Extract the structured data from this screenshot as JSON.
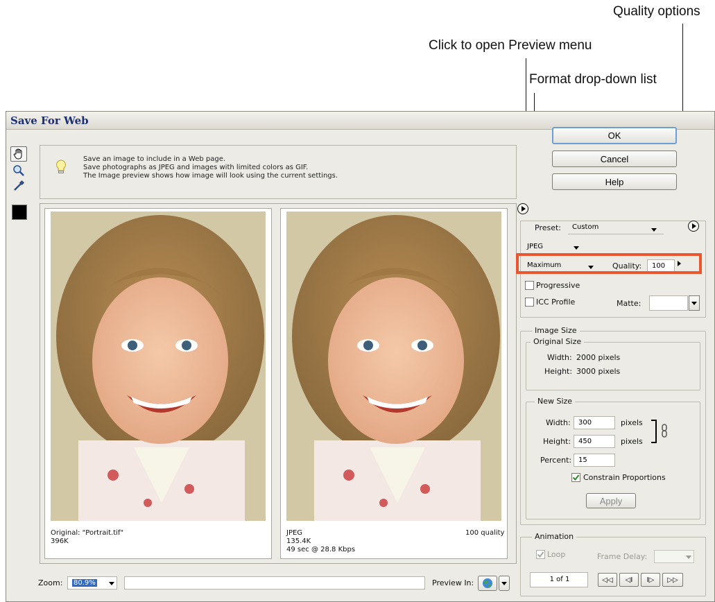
{
  "callouts": {
    "quality_options": "Quality options",
    "preview_menu": "Click to open Preview menu",
    "format_dropdown": "Format drop-down list"
  },
  "dialog": {
    "title": "Save For Web"
  },
  "info": {
    "line1": "Save an image to include in a Web page.",
    "line2": "Save photographs as JPEG and images with limited colors as GIF.",
    "line3": "The Image preview shows how image will look using the current settings."
  },
  "buttons": {
    "ok": "OK",
    "cancel": "Cancel",
    "help": "Help",
    "apply": "Apply"
  },
  "preset": {
    "label": "Preset:",
    "value": "Custom"
  },
  "format": {
    "value": "JPEG"
  },
  "quality": {
    "level": "Maximum",
    "label": "Quality:",
    "value": "100"
  },
  "options": {
    "progressive": "Progressive",
    "icc": "ICC Profile",
    "matte": "Matte:"
  },
  "image_size": {
    "legend": "Image Size",
    "original_legend": "Original Size",
    "width_label": "Width:",
    "width_value": "2000 pixels",
    "height_label": "Height:",
    "height_value": "3000 pixels",
    "new_legend": "New Size",
    "new_width": "300",
    "new_height": "450",
    "percent_label": "Percent:",
    "percent": "15",
    "pixels": "pixels",
    "constrain": "Constrain Proportions"
  },
  "animation": {
    "legend": "Animation",
    "loop": "Loop",
    "frame_delay": "Frame Delay:",
    "frame_counter": "1 of 1",
    "nav": [
      "◁◁",
      "◁I",
      "I▷",
      "▷▷"
    ]
  },
  "original_pane": {
    "name": "Original: \"Portrait.tif\"",
    "size": "396K"
  },
  "optimized_pane": {
    "format": "JPEG",
    "size": "135.4K",
    "time": "49 sec @ 28.8 Kbps",
    "quality": "100 quality"
  },
  "zoom": {
    "label": "Zoom:",
    "value": "80.9%"
  },
  "preview_in": {
    "label": "Preview In:"
  }
}
